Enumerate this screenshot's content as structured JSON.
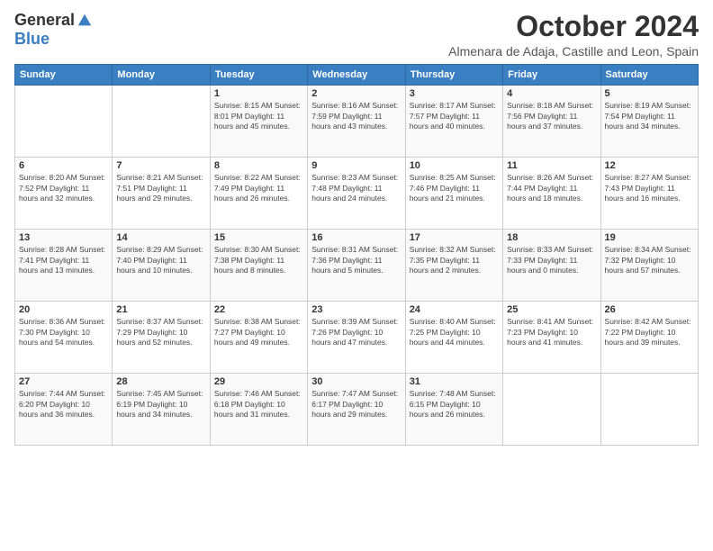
{
  "logo": {
    "general": "General",
    "blue": "Blue"
  },
  "title": {
    "month": "October 2024",
    "location": "Almenara de Adaja, Castille and Leon, Spain"
  },
  "headers": [
    "Sunday",
    "Monday",
    "Tuesday",
    "Wednesday",
    "Thursday",
    "Friday",
    "Saturday"
  ],
  "weeks": [
    [
      {
        "day": "",
        "info": ""
      },
      {
        "day": "",
        "info": ""
      },
      {
        "day": "1",
        "info": "Sunrise: 8:15 AM\nSunset: 8:01 PM\nDaylight: 11 hours and 45 minutes."
      },
      {
        "day": "2",
        "info": "Sunrise: 8:16 AM\nSunset: 7:59 PM\nDaylight: 11 hours and 43 minutes."
      },
      {
        "day": "3",
        "info": "Sunrise: 8:17 AM\nSunset: 7:57 PM\nDaylight: 11 hours and 40 minutes."
      },
      {
        "day": "4",
        "info": "Sunrise: 8:18 AM\nSunset: 7:56 PM\nDaylight: 11 hours and 37 minutes."
      },
      {
        "day": "5",
        "info": "Sunrise: 8:19 AM\nSunset: 7:54 PM\nDaylight: 11 hours and 34 minutes."
      }
    ],
    [
      {
        "day": "6",
        "info": "Sunrise: 8:20 AM\nSunset: 7:52 PM\nDaylight: 11 hours and 32 minutes."
      },
      {
        "day": "7",
        "info": "Sunrise: 8:21 AM\nSunset: 7:51 PM\nDaylight: 11 hours and 29 minutes."
      },
      {
        "day": "8",
        "info": "Sunrise: 8:22 AM\nSunset: 7:49 PM\nDaylight: 11 hours and 26 minutes."
      },
      {
        "day": "9",
        "info": "Sunrise: 8:23 AM\nSunset: 7:48 PM\nDaylight: 11 hours and 24 minutes."
      },
      {
        "day": "10",
        "info": "Sunrise: 8:25 AM\nSunset: 7:46 PM\nDaylight: 11 hours and 21 minutes."
      },
      {
        "day": "11",
        "info": "Sunrise: 8:26 AM\nSunset: 7:44 PM\nDaylight: 11 hours and 18 minutes."
      },
      {
        "day": "12",
        "info": "Sunrise: 8:27 AM\nSunset: 7:43 PM\nDaylight: 11 hours and 16 minutes."
      }
    ],
    [
      {
        "day": "13",
        "info": "Sunrise: 8:28 AM\nSunset: 7:41 PM\nDaylight: 11 hours and 13 minutes."
      },
      {
        "day": "14",
        "info": "Sunrise: 8:29 AM\nSunset: 7:40 PM\nDaylight: 11 hours and 10 minutes."
      },
      {
        "day": "15",
        "info": "Sunrise: 8:30 AM\nSunset: 7:38 PM\nDaylight: 11 hours and 8 minutes."
      },
      {
        "day": "16",
        "info": "Sunrise: 8:31 AM\nSunset: 7:36 PM\nDaylight: 11 hours and 5 minutes."
      },
      {
        "day": "17",
        "info": "Sunrise: 8:32 AM\nSunset: 7:35 PM\nDaylight: 11 hours and 2 minutes."
      },
      {
        "day": "18",
        "info": "Sunrise: 8:33 AM\nSunset: 7:33 PM\nDaylight: 11 hours and 0 minutes."
      },
      {
        "day": "19",
        "info": "Sunrise: 8:34 AM\nSunset: 7:32 PM\nDaylight: 10 hours and 57 minutes."
      }
    ],
    [
      {
        "day": "20",
        "info": "Sunrise: 8:36 AM\nSunset: 7:30 PM\nDaylight: 10 hours and 54 minutes."
      },
      {
        "day": "21",
        "info": "Sunrise: 8:37 AM\nSunset: 7:29 PM\nDaylight: 10 hours and 52 minutes."
      },
      {
        "day": "22",
        "info": "Sunrise: 8:38 AM\nSunset: 7:27 PM\nDaylight: 10 hours and 49 minutes."
      },
      {
        "day": "23",
        "info": "Sunrise: 8:39 AM\nSunset: 7:26 PM\nDaylight: 10 hours and 47 minutes."
      },
      {
        "day": "24",
        "info": "Sunrise: 8:40 AM\nSunset: 7:25 PM\nDaylight: 10 hours and 44 minutes."
      },
      {
        "day": "25",
        "info": "Sunrise: 8:41 AM\nSunset: 7:23 PM\nDaylight: 10 hours and 41 minutes."
      },
      {
        "day": "26",
        "info": "Sunrise: 8:42 AM\nSunset: 7:22 PM\nDaylight: 10 hours and 39 minutes."
      }
    ],
    [
      {
        "day": "27",
        "info": "Sunrise: 7:44 AM\nSunset: 6:20 PM\nDaylight: 10 hours and 36 minutes."
      },
      {
        "day": "28",
        "info": "Sunrise: 7:45 AM\nSunset: 6:19 PM\nDaylight: 10 hours and 34 minutes."
      },
      {
        "day": "29",
        "info": "Sunrise: 7:46 AM\nSunset: 6:18 PM\nDaylight: 10 hours and 31 minutes."
      },
      {
        "day": "30",
        "info": "Sunrise: 7:47 AM\nSunset: 6:17 PM\nDaylight: 10 hours and 29 minutes."
      },
      {
        "day": "31",
        "info": "Sunrise: 7:48 AM\nSunset: 6:15 PM\nDaylight: 10 hours and 26 minutes."
      },
      {
        "day": "",
        "info": ""
      },
      {
        "day": "",
        "info": ""
      }
    ]
  ]
}
